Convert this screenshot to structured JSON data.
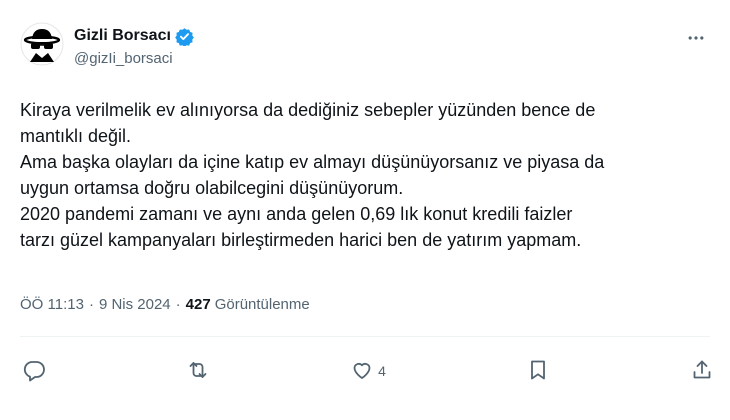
{
  "user": {
    "display_name": "Gizli Borsacı",
    "handle": "@gizIi_borsaci"
  },
  "tweet": {
    "text": "Kiraya verilmelik ev alınıyorsa da dediğiniz sebepler yüzünden bence de\nmantıklı değil.\nAma başka olayları da içine katıp ev almayı düşünüyorsanız ve piyasa da\nuygun ortamsa doğru olabilcegini düşünüyorum.\n2020 pandemi zamanı ve aynı anda gelen 0,69 lık konut kredili faizler\ntarzı güzel kampanyaları birleştirmeden harici ben de yatırım yapmam."
  },
  "meta": {
    "time": "ÖÖ 11:13",
    "separator": "·",
    "date": "9 Nis 2024",
    "views_count": "427",
    "views_label": "Görüntülenme"
  },
  "actions": {
    "likes_count": "4"
  },
  "icons": {
    "avatar": "spy-avatar-icon",
    "verified": "verified-badge-icon",
    "more": "more-icon",
    "reply": "reply-icon",
    "retweet": "retweet-icon",
    "like": "heart-icon",
    "share": "share-icon"
  },
  "colors": {
    "verified": "#1d9bf0",
    "text": "#0f1419",
    "secondary": "#536471",
    "divider": "#eff3f4"
  }
}
